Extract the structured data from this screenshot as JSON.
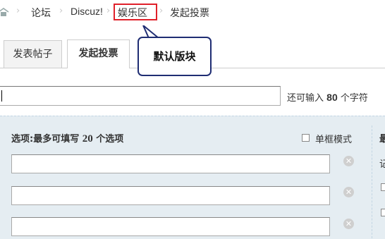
{
  "breadcrumb": {
    "items": [
      "论坛",
      "Discuz!",
      "娱乐区",
      "发起投票"
    ],
    "separator": "›"
  },
  "tabs": [
    {
      "label": "发表帖子",
      "active": false
    },
    {
      "label": "发起投票",
      "active": true
    }
  ],
  "callout": {
    "text": "默认版块"
  },
  "subject": {
    "value": "",
    "remaining_prefix": "还可输入",
    "remaining_count": "80",
    "remaining_suffix": "个字符"
  },
  "poll": {
    "title_prefix": "选项:最多可填写",
    "max_options": "20",
    "title_suffix": "个选项",
    "single_mode_label": "单框模式",
    "options": [
      "",
      "",
      ""
    ],
    "side_labels": [
      "最",
      "记"
    ]
  },
  "colors": {
    "highlight_border": "#e0202a",
    "callout_border": "#1f2d73",
    "panel_bg": "#e5edf2"
  }
}
